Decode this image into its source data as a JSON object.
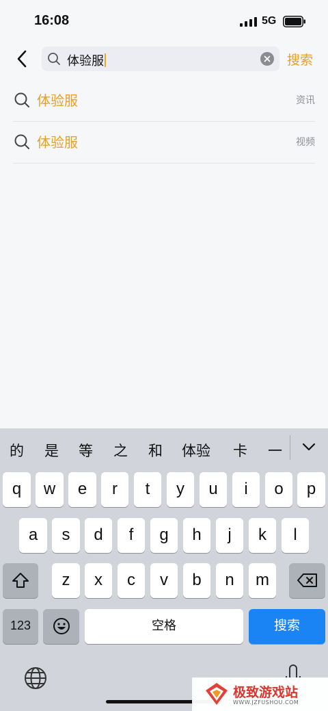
{
  "status_bar": {
    "time": "16:08",
    "network": "5G"
  },
  "search": {
    "query": "体验服",
    "submit_label": "搜索"
  },
  "suggestions": [
    {
      "text": "体验服",
      "tag": "资讯"
    },
    {
      "text": "体验服",
      "tag": "视频"
    }
  ],
  "keyboard": {
    "candidates": [
      "的",
      "是",
      "等",
      "之",
      "和",
      "体验",
      "卡",
      "一"
    ],
    "row1": [
      "q",
      "w",
      "e",
      "r",
      "t",
      "y",
      "u",
      "i",
      "o",
      "p"
    ],
    "row2": [
      "a",
      "s",
      "d",
      "f",
      "g",
      "h",
      "j",
      "k",
      "l"
    ],
    "row3": [
      "z",
      "x",
      "c",
      "v",
      "b",
      "n",
      "m"
    ],
    "num_label": "123",
    "space_label": "空格",
    "return_label": "搜索"
  },
  "watermark": {
    "name": "极致游戏站",
    "url": "WWW.JZFUSHOU.COM"
  }
}
